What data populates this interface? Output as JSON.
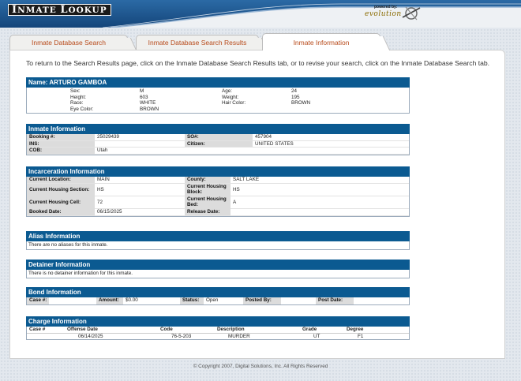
{
  "header": {
    "logo_text": "Inmate Lookup",
    "logo_part1_big": "I",
    "logo_part1_rest": "NMATE ",
    "logo_part2_big": "L",
    "logo_part2_rest": "OOKUP",
    "powered_by": "powered by:",
    "brand": "evolution",
    "accent": "#14457a"
  },
  "tabs": [
    {
      "label": "Inmate Database Search",
      "active": false
    },
    {
      "label": "Inmate Database Search Results",
      "active": false
    },
    {
      "label": "Inmate Information",
      "active": true
    }
  ],
  "intro": "To return to the Search Results page, click on the Inmate Database Search Results tab, or to revise your search, click on the Inmate Database Search tab.",
  "name_section": {
    "title": "Name: ARTURO GAMBOA",
    "sex_label": "Sex:",
    "sex": "M",
    "age_label": "Age:",
    "age": "24",
    "height_label": "Height:",
    "height": "603",
    "weight_label": "Weight:",
    "weight": "195",
    "race_label": "Race:",
    "race": "WHITE",
    "hair_label": "Hair Color:",
    "hair": "BROWN",
    "eye_label": "Eye Color:",
    "eye": "BROWN"
  },
  "inmate_info": {
    "title": "Inmate Information",
    "booking_label": "Booking #:",
    "booking": "25029439",
    "so_label": "SO#:",
    "so": "457904",
    "ins_label": "INS:",
    "ins": "",
    "citizen_label": "Citizen:",
    "citizen": "UNITED STATES",
    "cob_label": "COB:",
    "cob": "Utah"
  },
  "incarceration": {
    "title": "Incarceration Information",
    "location_label": "Current Location:",
    "location": "MAIN",
    "county_label": "County:",
    "county": "SALT LAKE",
    "section_label": "Current Housing Section:",
    "section": "HS",
    "block_label": "Current Housing Block:",
    "block": "HS",
    "cell_label": "Current Housing Cell:",
    "cell": "72",
    "bed_label": "Current Housing Bed:",
    "bed": "A",
    "booked_label": "Booked Date:",
    "booked": "06/15/2025",
    "release_label": "Release Date:",
    "release": ""
  },
  "alias": {
    "title": "Alias Information",
    "text": "There are no aliases for this inmate."
  },
  "detainer": {
    "title": "Detainer Information",
    "text": "There is no detainer information for this inmate."
  },
  "bond": {
    "title": "Bond Information",
    "case_label": "Case #:",
    "case": "",
    "amount_label": "Amount:",
    "amount": "$0.00",
    "status_label": "Status:",
    "status": "Open",
    "posted_label": "Posted By:",
    "posted": "",
    "postdate_label": "Post Date:",
    "postdate": ""
  },
  "charge": {
    "title": "Charge Information",
    "columns": [
      "Case #",
      "Offense Date",
      "Code",
      "Description",
      "Grade",
      "Degree"
    ],
    "rows": [
      [
        "",
        "06/14/2025",
        "76-5-203",
        "MURDER",
        "UT",
        "F1"
      ]
    ]
  },
  "footer": "© Copyright 2007, Digital Solutions, Inc. All Rights Reserved"
}
